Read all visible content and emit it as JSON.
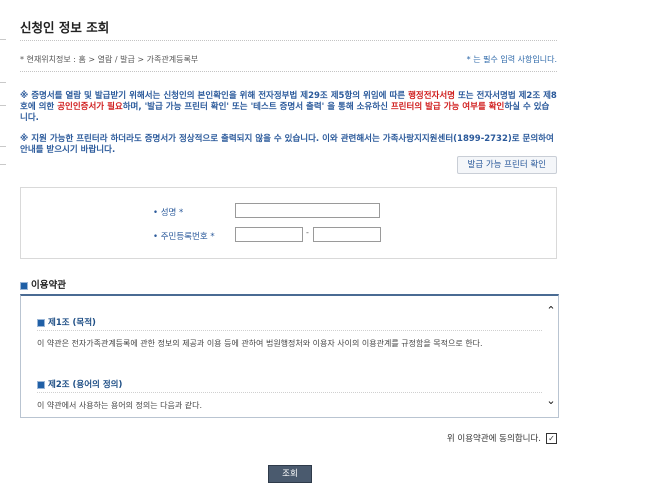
{
  "page_title": "신청인 정보 조회",
  "location": "* 현재위치정보 : 홈 > 열람 / 발급 > 가족관계등록부",
  "required_note": "* 는 필수 입력 사항입니다.",
  "notice1": {
    "a": "※ 증명서를 열람 및 발급받기 위해서는 신청인의 본인확인을 위해 전자정부법 제29조 제5항의 위임에 따른 ",
    "b": "행정전자서명",
    "c": " 또는 전자서명법 제2조 제8호에 의한 ",
    "d": "공인인증서가 필요",
    "e": "하며, '발급 가능 프린터 확인' 또는 '테스트 증명서 출력' 을 통해 소유하신 ",
    "f": "프린터의 발급 가능 여부를 확인",
    "g": "하실 수 있습니다."
  },
  "notice2": "※ 지원 가능한 프린터라 하더라도 증명서가 정상적으로 출력되지 않을 수 있습니다. 이와 관련해서는 가족사랑지지원센터(1899-2732)로 문의하여 안내를 받으시기 바랍니다.",
  "printer_button": "발급 가능 프린터 확인",
  "form": {
    "name_label": "• 성명 *",
    "name_value": "",
    "rrn_label": "• 주민등록번호 *",
    "rrn_front_value": "",
    "rrn_back_value": "",
    "rrn_dash": "-"
  },
  "terms": {
    "section_title": "이용약관",
    "articles": [
      {
        "title": "제1조 (목적)",
        "text": "이 약관은 전자가족관계등록에 관한 정보의 제공과 이용 등에 관하여 법원행정처와 이용자 사이의 이용관계를 규정함을 목적으로 한다."
      },
      {
        "title": "제2조 (용어의 정의)",
        "text": "이 약관에서 사용하는 용어의 정의는 다음과 같다."
      }
    ]
  },
  "agree_label": "위 이용약관에 동의합니다.",
  "agree_checked": "✓",
  "submit_label": "조회",
  "icons": {
    "scroll_up": "chevron-up-icon",
    "scroll_down": "chevron-down-icon",
    "bullet": "square-bullet-icon"
  },
  "colors": {
    "accent": "#2b5a9b",
    "highlight": "#d01d1d",
    "button_dark": "#4a5a6e"
  }
}
